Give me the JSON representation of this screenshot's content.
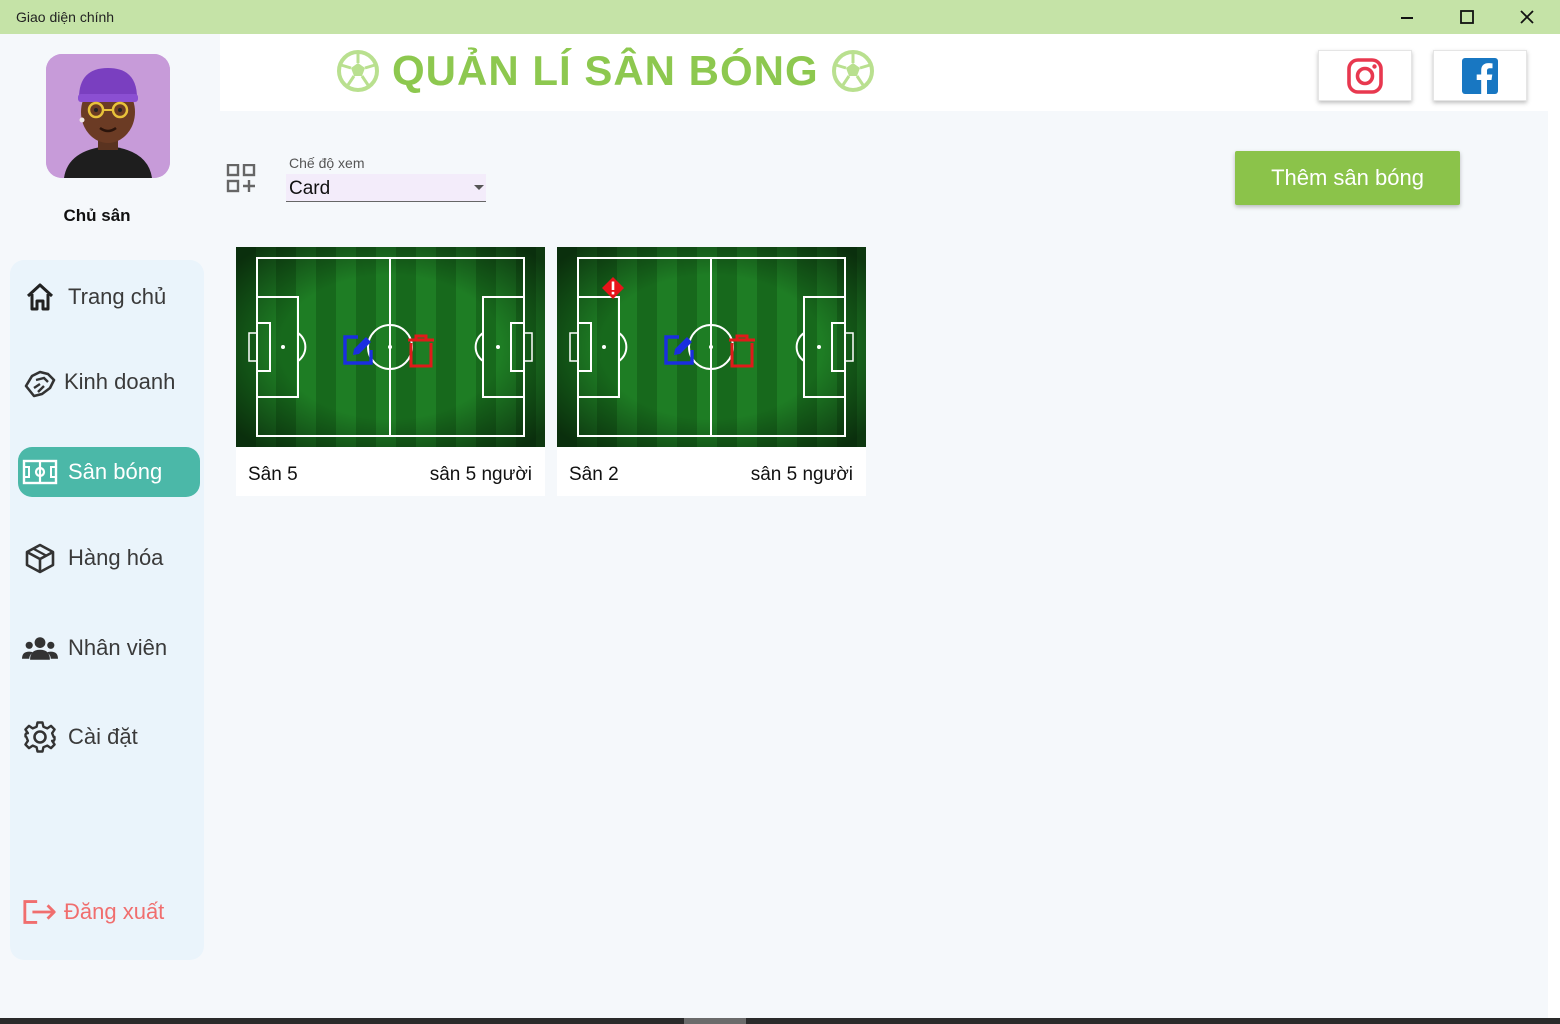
{
  "window": {
    "title": "Giao diện chính",
    "controls": [
      "minimize",
      "maximize",
      "close"
    ]
  },
  "sidebar": {
    "owner": "Chủ sân",
    "items": [
      {
        "label": "Trang chủ",
        "icon": "home-icon",
        "active": false
      },
      {
        "label": "Kinh doanh",
        "icon": "handshake-icon",
        "active": false
      },
      {
        "label": "Sân bóng",
        "icon": "pitch-icon",
        "active": true
      },
      {
        "label": "Hàng hóa",
        "icon": "box-icon",
        "active": false
      },
      {
        "label": "Nhân viên",
        "icon": "people-icon",
        "active": false
      },
      {
        "label": "Cài đặt",
        "icon": "gear-icon",
        "active": false
      }
    ],
    "logout": {
      "label": "Đăng xuất",
      "icon": "logout-icon"
    }
  },
  "header": {
    "title": "QUẢN LÍ SÂN BÓNG",
    "social": [
      "instagram-icon",
      "facebook-icon"
    ]
  },
  "toolbar": {
    "view_mode_label": "Chế độ xem",
    "view_mode_value": "Card",
    "add_button": "Thêm sân bóng"
  },
  "fields": [
    {
      "name": "Sân 5",
      "type": "sân 5 người",
      "warning": false
    },
    {
      "name": "Sân 2",
      "type": "sân 5 người",
      "warning": true
    }
  ],
  "colors": {
    "titlebar": "#c5e3a7",
    "accent_green": "#8bc34a",
    "active_nav": "#4bb8a8",
    "logout": "#f06e6e",
    "edit": "#1a2ee0",
    "delete": "#e01a1a"
  }
}
